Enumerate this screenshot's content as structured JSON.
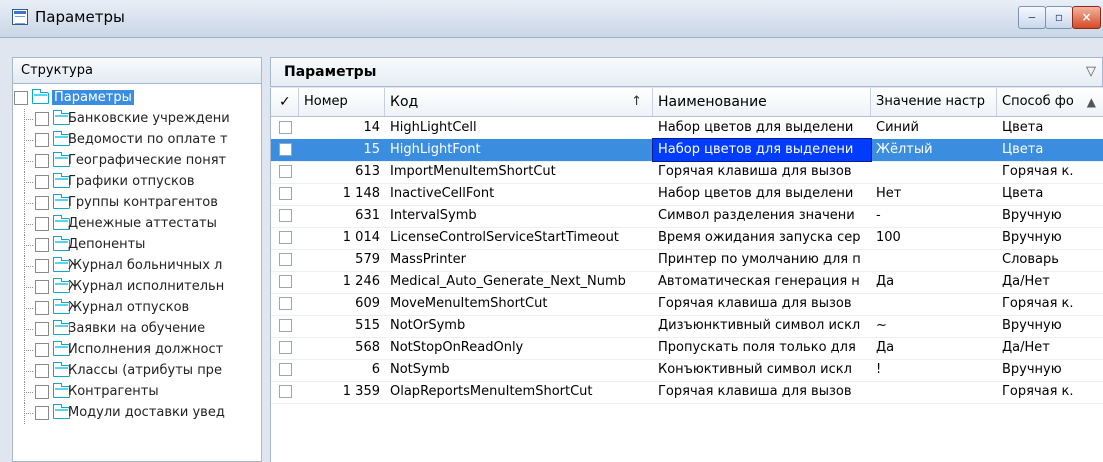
{
  "window": {
    "title": "Параметры",
    "buttons": [
      "minimize",
      "maximize",
      "close"
    ],
    "accent_color": "#3b8de0"
  },
  "left_panel": {
    "header": "Структура",
    "tree": [
      {
        "label": "Параметры",
        "selected": true
      },
      {
        "label": "Банковские учреждени"
      },
      {
        "label": "Ведомости по оплате т"
      },
      {
        "label": "Географические понят"
      },
      {
        "label": "Графики отпусков"
      },
      {
        "label": "Группы контрагентов"
      },
      {
        "label": "Денежные аттестаты"
      },
      {
        "label": "Депоненты"
      },
      {
        "label": "Журнал больничных л"
      },
      {
        "label": "Журнал исполнительн"
      },
      {
        "label": "Журнал отпусков"
      },
      {
        "label": "Заявки на обучение"
      },
      {
        "label": "Исполнения должност"
      },
      {
        "label": "Классы (атрибуты пре"
      },
      {
        "label": "Контрагенты"
      },
      {
        "label": "Модули доставки увед"
      }
    ]
  },
  "right_panel": {
    "title": "Параметры",
    "filter_icon": "filter-icon",
    "columns": [
      {
        "label": "✓"
      },
      {
        "label": "Номер"
      },
      {
        "label": "Код",
        "sort": "↑"
      },
      {
        "label": "Наименование"
      },
      {
        "label": "Значение настр"
      },
      {
        "label": "Способ фо"
      }
    ],
    "rows": [
      {
        "number": "14",
        "code": "HighLightCell",
        "name": "Набор цветов для выделени",
        "value": "Синий",
        "method": "Цвета",
        "selected": false
      },
      {
        "number": "15",
        "code": "HighLightFont",
        "name": "Набор цветов для выделени",
        "value": "Жёлтый",
        "method": "Цвета",
        "selected": true
      },
      {
        "number": "613",
        "code": "ImportMenuItemShortCut",
        "name": "Горячая клавиша для вызов",
        "value": "",
        "method": "Горячая к."
      },
      {
        "number": "1 148",
        "code": "InactiveCellFont",
        "name": "Набор цветов для выделени",
        "value": "Нет",
        "method": "Цвета"
      },
      {
        "number": "631",
        "code": "IntervalSymb",
        "name": "Символ разделения значени",
        "value": "-",
        "method": "Вручную"
      },
      {
        "number": "1 014",
        "code": "LicenseControlServiceStartTimeout",
        "name": "Время ожидания запуска сер",
        "value": "100",
        "method": "Вручную"
      },
      {
        "number": "579",
        "code": "MassPrinter",
        "name": "Принтер по умолчанию для п",
        "value": "",
        "method": "Словарь"
      },
      {
        "number": "1 246",
        "code": "Medical_Auto_Generate_Next_Numb",
        "name": "Автоматическая генерация н",
        "value": "Да",
        "method": "Да/Нет"
      },
      {
        "number": "609",
        "code": "MoveMenuItemShortCut",
        "name": "Горячая клавиша для вызов",
        "value": "",
        "method": "Горячая к."
      },
      {
        "number": "515",
        "code": "NotOrSymb",
        "name": "Дизъюнктивный символ искл",
        "value": "~",
        "method": "Вручную"
      },
      {
        "number": "568",
        "code": "NotStopOnReadOnly",
        "name": "Пропускать поля только для",
        "value": "Да",
        "method": "Да/Нет"
      },
      {
        "number": "6",
        "code": "NotSymb",
        "name": "Конъюктивный символ искл",
        "value": "!",
        "method": "Вручную"
      },
      {
        "number": "1 359",
        "code": "OlapReportsMenuItemShortCut",
        "name": "Горячая клавиша для вызов",
        "value": "",
        "method": "Горячая к."
      }
    ]
  }
}
